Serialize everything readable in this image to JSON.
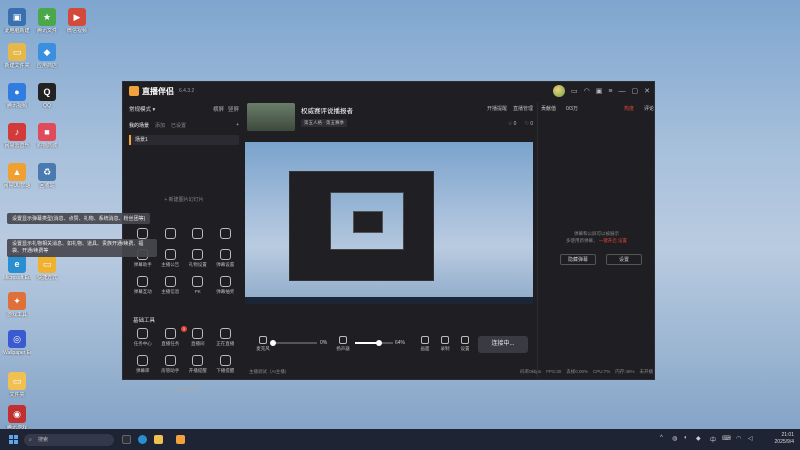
{
  "desktop": {
    "icons": [
      {
        "label": "此电脑新建\nmp4",
        "color": "#3a6fb0",
        "glyph": "▣"
      },
      {
        "label": "腾讯文件",
        "color": "#4aa84a",
        "glyph": "★"
      },
      {
        "label": "微信视频",
        "color": "#d34a3a",
        "glyph": "▶"
      },
      {
        "label": "新建文件夹",
        "color": "#e6b84a",
        "glyph": "▭"
      },
      {
        "label": "应用商店",
        "color": "#3a8fe0",
        "glyph": "◆"
      },
      {
        "label": "腾讯视频",
        "color": "#2f7de0",
        "glyph": "●"
      },
      {
        "label": "QQ",
        "color": "#222",
        "glyph": "Q"
      },
      {
        "label": "网易云音乐",
        "color": "#d33a3a",
        "glyph": "♪"
      },
      {
        "label": "购物商城",
        "color": "#e04a5a",
        "glyph": "■"
      },
      {
        "label": "网易UU加速",
        "color": "#f0a030",
        "glyph": "▲"
      },
      {
        "label": "回收站",
        "color": "#4a7ab0",
        "glyph": "♻"
      },
      {
        "label": "Microsoft Edge",
        "color": "#2a8fd0",
        "glyph": "e"
      },
      {
        "label": "快捷方式",
        "color": "#f0b030",
        "glyph": "▭"
      },
      {
        "label": "游戏工具",
        "color": "#e0703a",
        "glyph": "✦"
      },
      {
        "label": "Wallpaper Engine",
        "color": "#3a5ad0",
        "glyph": "◎"
      },
      {
        "label": "文件夹",
        "color": "#f0c050",
        "glyph": "▭"
      },
      {
        "label": "腾讯游戏",
        "color": "#c03030",
        "glyph": "◉"
      }
    ]
  },
  "app": {
    "brand": "直播伴侣",
    "version": "6.4.3.2",
    "left": {
      "mode": "常规模式 ▾",
      "mode_actions": [
        "横屏",
        "竖屏"
      ],
      "scene_tabs": [
        "我的场景",
        "添加",
        "已设置"
      ],
      "scene_item": "场景1",
      "add_scene": "+ 新建图片幻灯片",
      "top_tools": [
        "",
        "",
        "",
        "",
        "弹幕助手",
        "主播公告",
        "礼物设置",
        "弹幕设置",
        "弹幕互动",
        "主播信息",
        "PK",
        "弹幕抽奖"
      ],
      "tools_title": "基础工具",
      "basic_tools": [
        "任务中心",
        "直播任务",
        "直播间",
        "正在直播",
        "弹幕库",
        "房管助手",
        "开播提醒",
        "下播提醒"
      ],
      "badge": "1",
      "more": "••• 更多功能"
    },
    "tooltip1": "设置显示弹幕类型(消息、点赞、礼物、系统消息、粉丝团等)",
    "tooltip2": "设置显示礼物相关消息、如礼物、道具、贵族开通/续费、福袋、开通/续费等",
    "stream": {
      "title": "权威赛评说播报者",
      "category": "第五人格 · 第五赛季",
      "actions": [
        "开播提醒",
        "直播管理"
      ],
      "likes": "0",
      "hearts": "0"
    },
    "controls": {
      "mic_label": "麦克风",
      "mic_pct": "0%",
      "spk_label": "扬声器",
      "spk_pct": "64%",
      "extra": [
        "画面",
        "录制",
        "设置"
      ],
      "live_button": "连接中..."
    },
    "status": {
      "left": "主播调试（AI主播）",
      "right": [
        "码率0kbps",
        "FPS:30",
        "丢帧0.00%",
        "CPU:7%",
        "内存:46%",
        "未开播"
      ]
    },
    "right": {
      "tabs": [
        "贡献值",
        "0/3万"
      ],
      "hot": "热度",
      "extra": "评论",
      "info_line1": "弹幕和公屏可以被展示",
      "info_line2": "多使用新弹幕，",
      "link": "一键开启",
      "info_line3": "设置",
      "btn_hide": "隐藏弹幕",
      "btn_settings": "设置"
    }
  },
  "taskbar": {
    "search": "搜索",
    "time": "21:01",
    "date": "2025/9/4",
    "lang": "中"
  },
  "progress": {
    "mic": 0.0,
    "speaker": 0.64
  }
}
